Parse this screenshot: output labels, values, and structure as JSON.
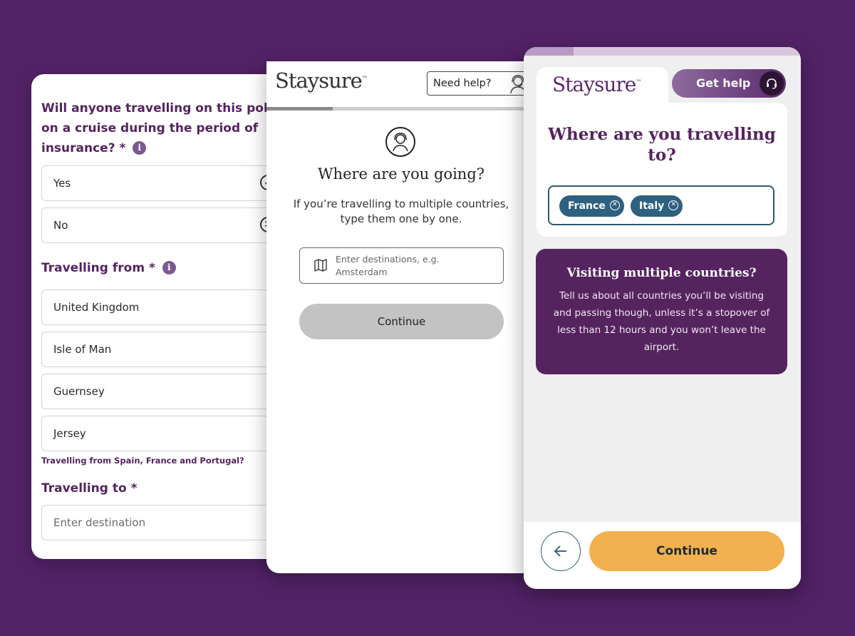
{
  "card1": {
    "cruise_question_line1": "Will anyone travelling on this policy go",
    "cruise_question_line2": "on a cruise during the period of",
    "cruise_question_line3": "insurance? *",
    "info_glyph": "i",
    "option_yes": "Yes",
    "option_no": "No",
    "travelling_from_label": "Travelling from *",
    "from_options": [
      "United Kingdom",
      "Isle of Man",
      "Guernsey",
      "Jersey"
    ],
    "spain_note": "Travelling from Spain, France and Portugal?",
    "travelling_to_label": "Travelling to *",
    "destination_placeholder": "Enter destination",
    "icons": {
      "yes": "check-circle-icon",
      "no": "x-circle-icon",
      "info": "info-icon"
    }
  },
  "card2": {
    "logo": "Staysure",
    "logo_tm": "™",
    "need_help": "Need help?",
    "title": "Where are you going?",
    "subtitle": "If you’re travelling to multiple countries, type them one by one.",
    "destination_placeholder": "Enter destinations, e.g. Amsterdam",
    "continue_label": "Continue",
    "progress": 0.24,
    "icons": {
      "help": "agent-headset-icon",
      "avatar": "agent-avatar-icon",
      "input": "map-icon"
    }
  },
  "card3": {
    "logo": "Staysure",
    "logo_tm": "™",
    "get_help": "Get help",
    "title": "Where are you travelling to?",
    "chips": [
      "France",
      "Italy"
    ],
    "info_title": "Visiting multiple countries?",
    "info_body": "Tell us about all countries you’ll be visiting and passing though, unless it’s a stopover of less than 12 hours and you won’t leave the airport.",
    "continue_label": "Continue",
    "progress": 0.18,
    "colors": {
      "brand_purple": "#55245f",
      "chip_blue": "#2e6080",
      "cta_orange": "#f3b04e"
    },
    "icons": {
      "help": "headset-icon",
      "chip_remove": "x-circle-icon",
      "back": "arrow-left-icon"
    }
  }
}
